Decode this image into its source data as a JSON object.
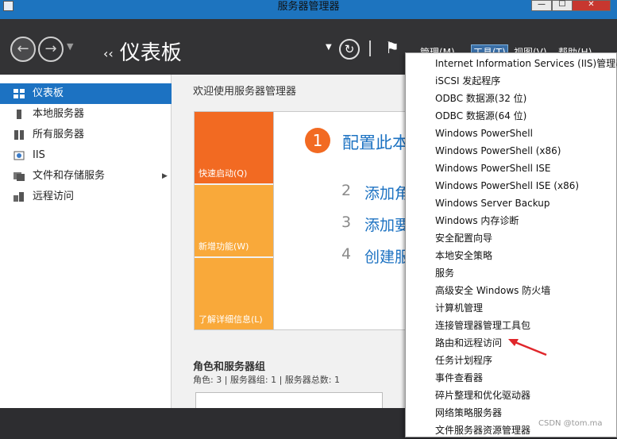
{
  "window": {
    "title": "服务器管理器",
    "min_label": "—",
    "max_label": "☐",
    "close_label": "✕"
  },
  "header": {
    "title": "仪表板",
    "menus": [
      "管理(M)",
      "工具(T)",
      "视图(V)",
      "帮助(H)"
    ]
  },
  "sidebar": {
    "items": [
      {
        "label": "仪表板",
        "icon": "dashboard-icon",
        "active": true
      },
      {
        "label": "本地服务器",
        "icon": "server-icon"
      },
      {
        "label": "所有服务器",
        "icon": "servers-icon"
      },
      {
        "label": "IIS",
        "icon": "iis-icon"
      },
      {
        "label": "文件和存储服务",
        "icon": "storage-icon",
        "has_submenu": true
      },
      {
        "label": "远程访问",
        "icon": "remote-access-icon"
      }
    ]
  },
  "main": {
    "welcome": "欢迎使用服务器管理器",
    "tiles": [
      "快速启动(Q)",
      "新增功能(W)",
      "了解详细信息(L)"
    ],
    "steps": [
      {
        "num": "1",
        "text": "配置此本"
      },
      {
        "num": "2",
        "text": "添加角"
      },
      {
        "num": "3",
        "text": "添加要"
      },
      {
        "num": "4",
        "text": "创建服"
      }
    ],
    "roles_title": "角色和服务器组",
    "roles_stats": "角色: 3 | 服务器组: 1 | 服务器总数: 1"
  },
  "tools_menu": {
    "items": [
      "Internet Information Services (IIS)管理器",
      "iSCSI 发起程序",
      "ODBC 数据源(32 位)",
      "ODBC 数据源(64 位)",
      "Windows PowerShell",
      "Windows PowerShell (x86)",
      "Windows PowerShell ISE",
      "Windows PowerShell ISE (x86)",
      "Windows Server Backup",
      "Windows 内存诊断",
      "安全配置向导",
      "本地安全策略",
      "服务",
      "高级安全 Windows 防火墙",
      "计算机管理",
      "连接管理器管理工具包",
      "路由和远程访问",
      "任务计划程序",
      "事件查看器",
      "碎片整理和优化驱动器",
      "网络策略服务器",
      "文件服务器资源管理器"
    ]
  },
  "watermark": "CSDN @tom.ma",
  "colors": {
    "accent": "#1c72c2",
    "tile_orange": "#f26a22",
    "tile_light": "#f9a93a",
    "annotation_arrow": "#e0262b"
  }
}
